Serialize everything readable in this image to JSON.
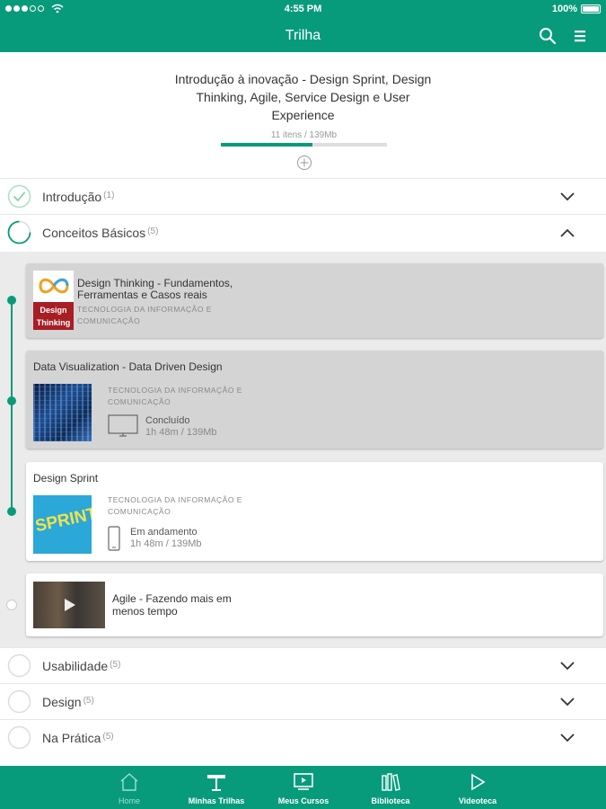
{
  "status_bar": {
    "time": "4:55 PM",
    "battery": "100%"
  },
  "header": {
    "title": "Trilha"
  },
  "trilha": {
    "title": "Introdução à inovação - Design Sprint, Design Thinking, Agile, Service Design e User Experience",
    "progress_label": "11 itens / 139Mb",
    "progress": 0.55
  },
  "sections": [
    {
      "name": "Introdução",
      "count": "(1)",
      "state": "complete",
      "expanded": false
    },
    {
      "name": "Conceitos Básicos",
      "count": "(5)",
      "state": "partial",
      "expanded": true
    },
    {
      "name": "Usabilidade",
      "count": "(5)",
      "state": "empty",
      "expanded": false
    },
    {
      "name": "Design",
      "count": "(5)",
      "state": "empty",
      "expanded": false
    },
    {
      "name": "Na Prática",
      "count": "(5)",
      "state": "empty",
      "expanded": false
    }
  ],
  "courses": [
    {
      "title_line1": "Design Thinking - Fundamentos,",
      "title_line2": "Ferramentas e Casos reais",
      "category_line1": "TECNOLOGIA DA INFORMAÇÃO E",
      "category_line2": "COMUNICAÇÃO",
      "thumb_text_1": "Design",
      "thumb_text_2": "Thinking"
    },
    {
      "title": "Data Visualization - Data Driven Design",
      "category_line1": "TECNOLOGIA DA INFORMAÇÃO E",
      "category_line2": "COMUNICAÇÃO",
      "status": "Concluído",
      "meta": "1h 48m / 139Mb",
      "device_icon": "desktop-icon"
    },
    {
      "title": "Design Sprint",
      "category_line1": "TECNOLOGIA DA INFORMAÇÃO E",
      "category_line2": "COMUNICAÇÃO",
      "status": "Em andamento",
      "meta": "1h 48m / 139Mb",
      "device_icon": "phone-icon",
      "thumb_text": "SPRINT"
    },
    {
      "title_line1": "Agile - Fazendo mais em",
      "title_line2": "menos tempo"
    }
  ],
  "tabs": [
    {
      "label": "Home",
      "icon": "home-icon",
      "active": true
    },
    {
      "label": "Minhas Trilhas",
      "icon": "signpost-icon",
      "active": false
    },
    {
      "label": "Meus Cursos",
      "icon": "video-screen-icon",
      "active": false
    },
    {
      "label": "Biblioteca",
      "icon": "books-icon",
      "active": false
    },
    {
      "label": "Videoteca",
      "icon": "play-icon",
      "active": false
    }
  ],
  "colors": {
    "primary": "#079b7c",
    "completed_card": "#d4d4d4",
    "background_expanded": "#ebebeb"
  }
}
